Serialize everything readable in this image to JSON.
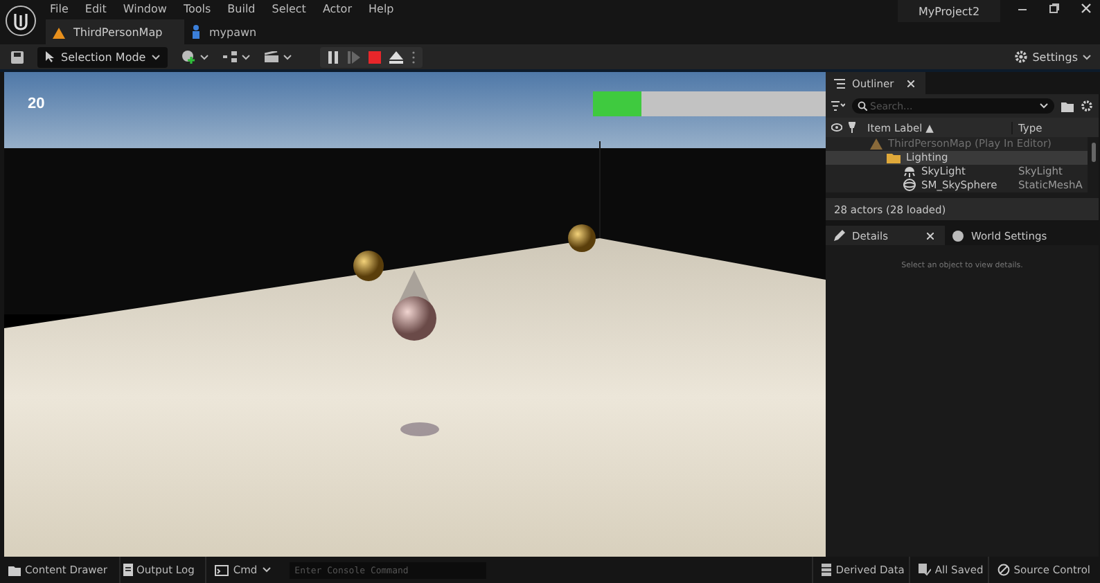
{
  "window": {
    "menu": [
      "File",
      "Edit",
      "Window",
      "Tools",
      "Build",
      "Select",
      "Actor",
      "Help"
    ],
    "project": "MyProject2"
  },
  "tabs": [
    {
      "label": "ThirdPersonMap",
      "selected": true,
      "kind": "map"
    },
    {
      "label": "mypawn",
      "selected": false,
      "kind": "blueprint"
    }
  ],
  "toolbar": {
    "mode": "Selection Mode",
    "play_controls": [
      {
        "kind": "pause",
        "disabled": false
      },
      {
        "kind": "step",
        "disabled": true
      },
      {
        "kind": "stop",
        "disabled": false
      },
      {
        "kind": "eject",
        "disabled": false
      }
    ],
    "settings": "Settings"
  },
  "viewport": {
    "score": "20",
    "health": {
      "level": 0.21
    }
  },
  "outliner": {
    "title": "Outliner",
    "search_placeholder": "Search...",
    "columns": [
      "Item Label ▲",
      "Type"
    ],
    "tree": [
      {
        "label": "ThirdPersonMap (Play In Editor)",
        "kind": "map",
        "selected": false,
        "children": [
          {
            "label": "Lighting",
            "kind": "folder",
            "selected": true,
            "children": [
              {
                "label": "SkyLight",
                "kind": "light",
                "type": "SkyLight",
                "selected": false
              },
              {
                "label": "SM_SkySphere",
                "kind": "mesh",
                "type": "StaticMeshA",
                "selected": false
              }
            ]
          }
        ]
      }
    ],
    "footer": "28 actors (28 loaded)"
  },
  "details_tabs": [
    {
      "label": "Details",
      "selected": true,
      "kind": "details"
    },
    {
      "label": "World Settings",
      "selected": false,
      "kind": "world"
    }
  ],
  "details_hint": "Select an object to view details.",
  "status_bar": {
    "left": [
      {
        "label": "Content Drawer",
        "kind": "drawer"
      },
      {
        "label": "Output Log",
        "kind": "log"
      }
    ],
    "cmd": "Cmd",
    "console_placeholder": "Enter Console Command",
    "right": [
      {
        "label": "Derived Data",
        "kind": "data"
      },
      {
        "label": "All Saved",
        "kind": "saved"
      },
      {
        "label": "Source Control",
        "kind": "source"
      }
    ]
  }
}
